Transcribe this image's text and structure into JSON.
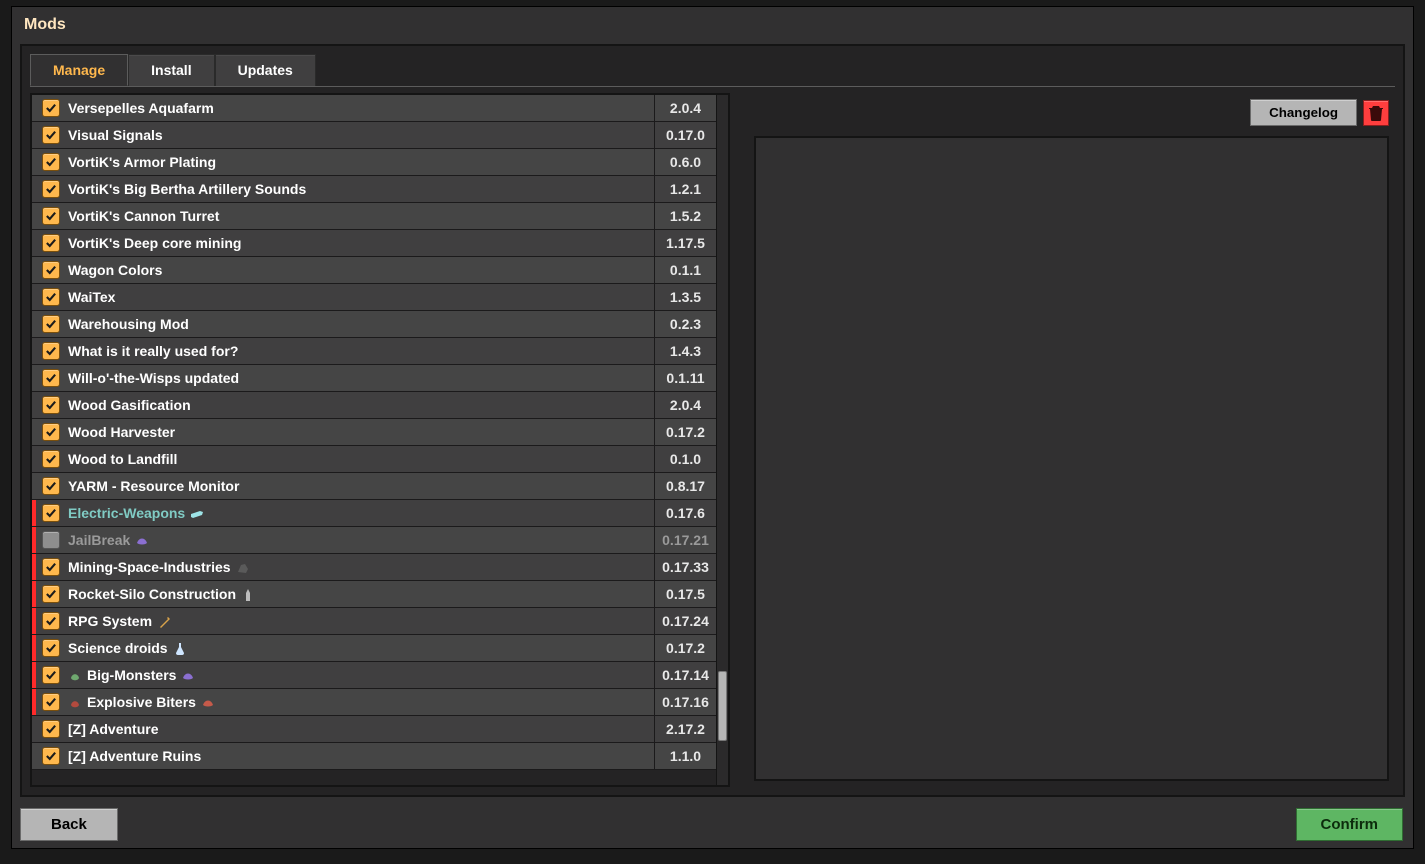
{
  "window": {
    "title": "Mods"
  },
  "tabs": [
    {
      "label": "Manage",
      "active": true
    },
    {
      "label": "Install",
      "active": false
    },
    {
      "label": "Updates",
      "active": false
    }
  ],
  "right": {
    "changelog_label": "Changelog"
  },
  "footer": {
    "back_label": "Back",
    "confirm_label": "Confirm"
  },
  "mods": [
    {
      "name": "Versepelles Aquafarm",
      "version": "2.0.4",
      "enabled": true
    },
    {
      "name": "Visual Signals",
      "version": "0.17.0",
      "enabled": true
    },
    {
      "name": "VortiK's Armor Plating",
      "version": "0.6.0",
      "enabled": true
    },
    {
      "name": "VortiK's Big Bertha Artillery Sounds",
      "version": "1.2.1",
      "enabled": true
    },
    {
      "name": "VortiK's Cannon Turret",
      "version": "1.5.2",
      "enabled": true
    },
    {
      "name": "VortiK's Deep core mining",
      "version": "1.17.5",
      "enabled": true
    },
    {
      "name": "Wagon Colors",
      "version": "0.1.1",
      "enabled": true
    },
    {
      "name": "WaiTex",
      "version": "1.3.5",
      "enabled": true
    },
    {
      "name": "Warehousing Mod",
      "version": "0.2.3",
      "enabled": true
    },
    {
      "name": "What is it really used for?",
      "version": "1.4.3",
      "enabled": true
    },
    {
      "name": "Will-o'-the-Wisps updated",
      "version": "0.1.11",
      "enabled": true
    },
    {
      "name": "Wood Gasification",
      "version": "2.0.4",
      "enabled": true
    },
    {
      "name": "Wood Harvester",
      "version": "0.17.2",
      "enabled": true
    },
    {
      "name": "Wood to Landfill",
      "version": "0.1.0",
      "enabled": true
    },
    {
      "name": "YARM - Resource Monitor",
      "version": "0.8.17",
      "enabled": true
    },
    {
      "name": "Electric-Weapons",
      "version": "0.17.6",
      "enabled": true,
      "red_flag": true,
      "highlight": true,
      "trailing_icon": "gun-icon"
    },
    {
      "name": "JailBreak",
      "version": "0.17.21",
      "enabled": false,
      "red_flag": true,
      "trailing_icon": "biter-icon"
    },
    {
      "name": "Mining-Space-Industries",
      "version": "0.17.33",
      "enabled": true,
      "red_flag": true,
      "trailing_icon": "rock-icon"
    },
    {
      "name": "Rocket-Silo Construction",
      "version": "0.17.5",
      "enabled": true,
      "red_flag": true,
      "trailing_icon": "silo-icon"
    },
    {
      "name": "RPG System",
      "version": "0.17.24",
      "enabled": true,
      "red_flag": true,
      "trailing_icon": "wand-icon"
    },
    {
      "name": "Science droids",
      "version": "0.17.2",
      "enabled": true,
      "red_flag": true,
      "trailing_icon": "flask-icon"
    },
    {
      "name": "Big-Monsters",
      "version": "0.17.14",
      "enabled": true,
      "red_flag": true,
      "leading_icon": "bug-icon",
      "trailing_icon": "biter-icon"
    },
    {
      "name": "Explosive Biters",
      "version": "0.17.16",
      "enabled": true,
      "red_flag": true,
      "leading_icon": "bug-red-icon",
      "trailing_icon": "biter-red-icon"
    },
    {
      "name": "[Z] Adventure",
      "version": "2.17.2",
      "enabled": true
    },
    {
      "name": "[Z] Adventure Ruins",
      "version": "1.1.0",
      "enabled": true
    }
  ]
}
